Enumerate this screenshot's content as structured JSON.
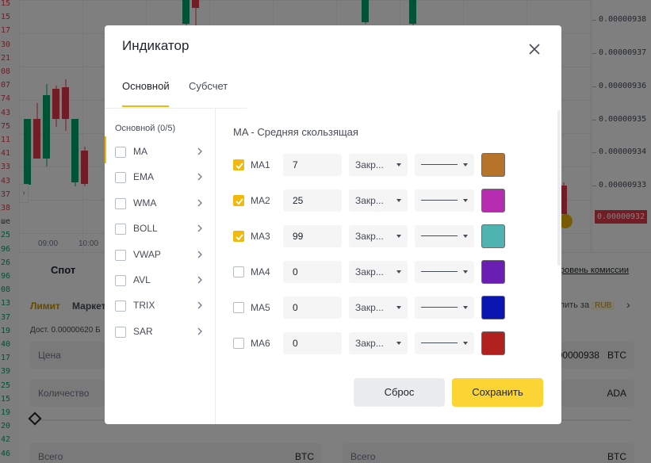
{
  "background": {
    "left_prices": [
      {
        "text": "15",
        "color": "#e23b4a"
      },
      {
        "text": "15",
        "color": "#e23b4a"
      },
      {
        "text": "17",
        "color": "#e23b4a"
      },
      {
        "text": "30",
        "color": "#e23b4a"
      },
      {
        "text": "21",
        "color": "#e23b4a"
      },
      {
        "text": "08",
        "color": "#e23b4a"
      },
      {
        "text": "07",
        "color": "#e23b4a"
      },
      {
        "text": "74",
        "color": "#e23b4a"
      },
      {
        "text": "43",
        "color": "#e23b4a"
      },
      {
        "text": "75",
        "color": "#e23b4a"
      },
      {
        "text": "11",
        "color": "#e23b4a"
      },
      {
        "text": "41",
        "color": "#e23b4a"
      },
      {
        "text": "33",
        "color": "#e23b4a"
      },
      {
        "text": "43",
        "color": "#e23b4a"
      },
      {
        "text": "37",
        "color": "#e23b4a"
      },
      {
        "text": "38",
        "color": "#e23b4a"
      },
      {
        "text": "ше",
        "color": "#474d57"
      },
      {
        "text": "25",
        "color": "#03a66d"
      },
      {
        "text": "96",
        "color": "#03a66d"
      },
      {
        "text": "26",
        "color": "#03a66d"
      },
      {
        "text": "96",
        "color": "#03a66d"
      },
      {
        "text": "08",
        "color": "#03a66d"
      },
      {
        "text": "13",
        "color": "#03a66d"
      },
      {
        "text": "37",
        "color": "#03a66d"
      },
      {
        "text": "19",
        "color": "#03a66d"
      },
      {
        "text": "40",
        "color": "#03a66d"
      },
      {
        "text": "17",
        "color": "#03a66d"
      },
      {
        "text": "39",
        "color": "#03a66d"
      },
      {
        "text": "25",
        "color": "#03a66d"
      },
      {
        "text": "15",
        "color": "#03a66d"
      },
      {
        "text": "19",
        "color": "#03a66d"
      },
      {
        "text": "20",
        "color": "#03a66d"
      },
      {
        "text": "42",
        "color": "#03a66d"
      },
      {
        "text": "46",
        "color": "#03a66d"
      }
    ],
    "right_axis": [
      "0.00000938",
      "0.00000937",
      "0.00000936",
      "0.00000935",
      "0.00000934",
      "0.00000933"
    ],
    "current_price": "0.00000932",
    "times": [
      "09:00",
      "10:00"
    ],
    "order": {
      "tab_spot": "Спот",
      "fee_link": "ровень комиссии",
      "limit": "Лимит",
      "market": "Маркет",
      "available": "Дост. 0.00000620 Б",
      "buy_for": "пить за",
      "rub": "RUB",
      "price_label": "Цена",
      "price_value": "00000938",
      "price_unit": "BTC",
      "qty_label": "Количество",
      "qty_unit": "ADA",
      "total_label": "Всего",
      "total_unit": "BTC",
      "total_label_2": "Всего",
      "total_unit_2": "BTC"
    }
  },
  "modal": {
    "title": "Индикатор",
    "tabs": [
      {
        "label": "Основной",
        "active": true
      },
      {
        "label": "Субсчет",
        "active": false
      }
    ],
    "sidebar": {
      "title": "Основной (0/5)",
      "items": [
        {
          "label": "MA",
          "icon": "chevron-right-icon"
        },
        {
          "label": "EMA",
          "icon": "chevron-right-icon"
        },
        {
          "label": "WMA",
          "icon": "chevron-right-icon"
        },
        {
          "label": "BOLL",
          "icon": "chevron-right-icon"
        },
        {
          "label": "VWAP",
          "icon": "chevron-right-icon"
        },
        {
          "label": "AVL",
          "icon": "chevron-right-icon"
        },
        {
          "label": "TRIX",
          "icon": "chevron-right-icon"
        },
        {
          "label": "SAR",
          "icon": "chevron-right-icon"
        }
      ]
    },
    "panel": {
      "title": "MA - Средняя скользящая",
      "rows": [
        {
          "name": "MA1",
          "checked": true,
          "period": "7",
          "source": "Закр...",
          "color": "#b5742a"
        },
        {
          "name": "MA2",
          "checked": true,
          "period": "25",
          "source": "Закр...",
          "color": "#b52cb0"
        },
        {
          "name": "MA3",
          "checked": true,
          "period": "99",
          "source": "Закр...",
          "color": "#4fb3b1"
        },
        {
          "name": "MA4",
          "checked": false,
          "period": "0",
          "source": "Закр...",
          "color": "#6a1fb2"
        },
        {
          "name": "MA5",
          "checked": false,
          "period": "0",
          "source": "Закр...",
          "color": "#0b16b2"
        },
        {
          "name": "MA6",
          "checked": false,
          "period": "0",
          "source": "Закр...",
          "color": "#b0221e"
        }
      ]
    },
    "buttons": {
      "reset": "Сброс",
      "save": "Сохранить"
    }
  }
}
